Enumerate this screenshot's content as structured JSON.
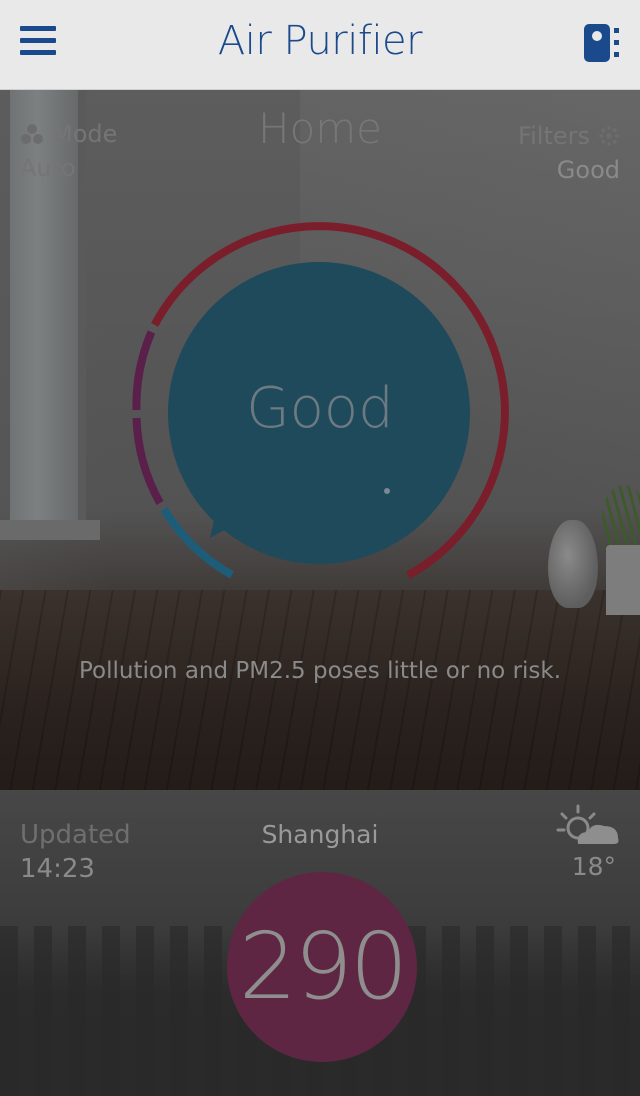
{
  "header": {
    "title": "Air Purifier",
    "menu_icon": "hamburger-menu-icon",
    "device_icon": "purifier-device-icon"
  },
  "room": {
    "location": "Home",
    "mode_label": "Mode",
    "mode_value": "Auto",
    "mode_icon": "fan-icon",
    "filters_label": "Filters",
    "filters_value": "Good",
    "filters_icon": "filter-icon",
    "indoor_status": "Good",
    "message": "Pollution and PM2.5 poses little or no risk."
  },
  "outdoor": {
    "updated_label": "Updated",
    "updated_time": "14:23",
    "city": "Shanghai",
    "temperature": "18°",
    "weather_icon": "partly-cloudy-icon",
    "aqi": "290"
  },
  "colors": {
    "brand": "#1b4a8c",
    "gauge_red": "#7a1e2b",
    "gauge_purple": "#5a1f4a",
    "gauge_blue": "#1e5d7a",
    "inner_circle": "#1f4a5c",
    "aqi_circle": "#5f2643"
  }
}
